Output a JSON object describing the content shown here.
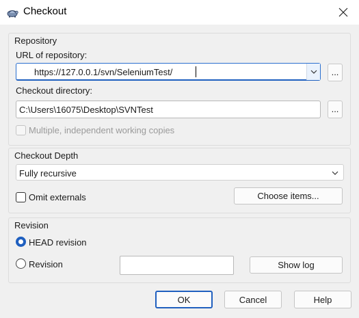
{
  "window": {
    "title": "Checkout",
    "icon": "tortoise-svn-icon",
    "close_icon": "close-icon"
  },
  "repository": {
    "group_label": "Repository",
    "url_label": "URL of repository:",
    "url_value": "https://127.0.0.1/svn/SeleniumTest/",
    "url_browse": "...",
    "dir_label": "Checkout directory:",
    "dir_value": "C:\\Users\\16075\\Desktop\\SVNTest",
    "dir_browse": "...",
    "multiple_copies_label": "Multiple, independent working copies",
    "multiple_copies_checked": false
  },
  "depth": {
    "group_label": "Checkout Depth",
    "selected": "Fully recursive",
    "omit_externals_label": "Omit externals",
    "omit_externals_checked": false,
    "choose_items_label": "Choose items..."
  },
  "revision": {
    "group_label": "Revision",
    "head_label": "HEAD revision",
    "head_selected": true,
    "revision_label": "Revision",
    "revision_value": "",
    "show_log_label": "Show log"
  },
  "buttons": {
    "ok": "OK",
    "cancel": "Cancel",
    "help": "Help"
  },
  "colors": {
    "accent": "#1f5fbf",
    "dialog_bg": "#f0f0f0"
  }
}
